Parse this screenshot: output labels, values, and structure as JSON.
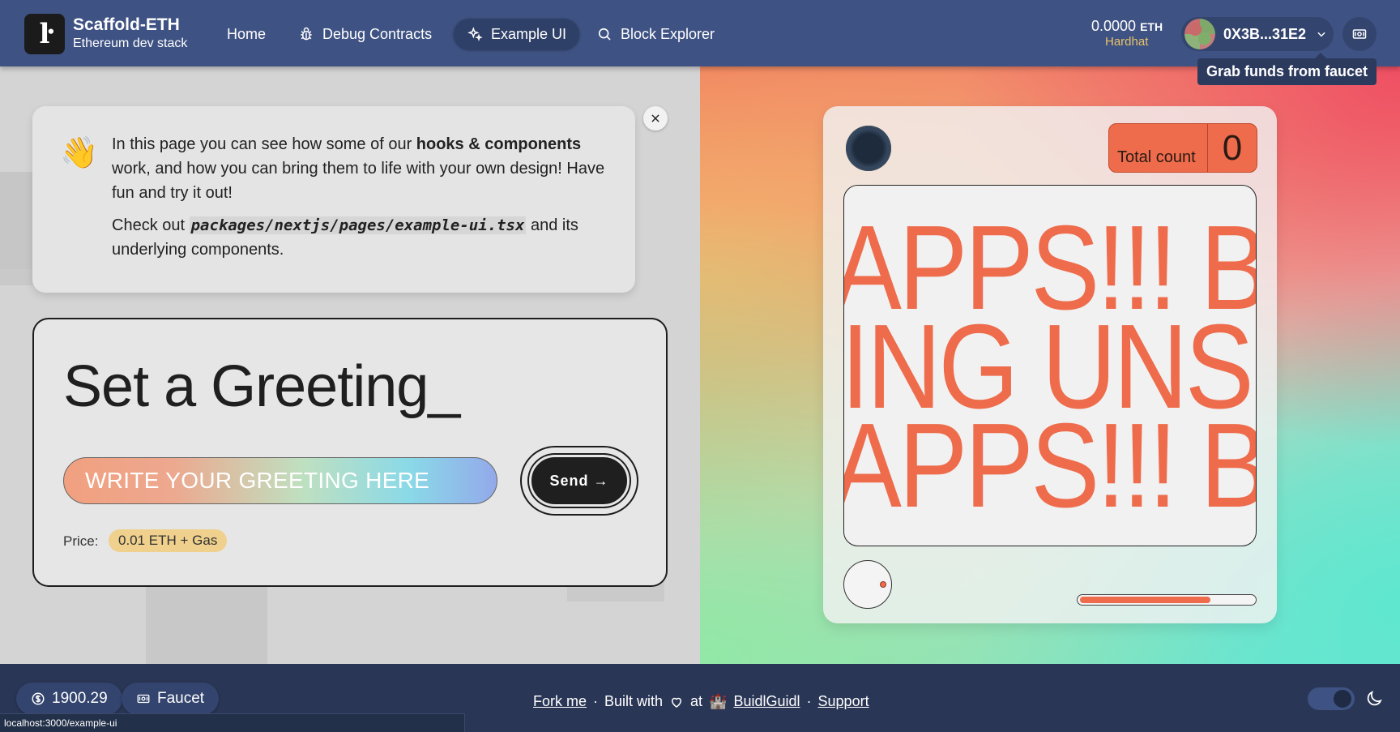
{
  "navbar": {
    "brand_title": "Scaffold-ETH",
    "brand_subtitle": "Ethereum dev stack",
    "links": [
      {
        "label": "Home",
        "icon": "none"
      },
      {
        "label": "Debug Contracts",
        "icon": "bug-icon"
      },
      {
        "label": "Example UI",
        "icon": "sparkles-icon",
        "active": true
      },
      {
        "label": "Block Explorer",
        "icon": "search-icon"
      }
    ],
    "balance": "0.0000",
    "balance_unit": "ETH",
    "network": "Hardhat",
    "network_color": "#e8c26a",
    "address": "0X3B...31E2",
    "faucet_tooltip": "Grab funds from faucet"
  },
  "info": {
    "line1_prefix": "In this page you can see how some of our ",
    "line1_bold": "hooks & components",
    "line1_suffix": " work, and how you can bring them to life with your own design! Have fun and try it out!",
    "line2_prefix": "Check out ",
    "line2_code": "packages/nextjs/pages/example-ui.tsx",
    "line2_suffix": " and its underlying components."
  },
  "greeting": {
    "title": "Set a Greeting_",
    "input_placeholder": "WRITE YOUR GREETING HERE",
    "send_label": "Send →",
    "price_label": "Price:",
    "price_value": "0.01 ETH + Gas"
  },
  "contract_card": {
    "count_label": "Total count",
    "count_value": "0",
    "marquee_lines": [
      "APPS!!! B",
      "ING UNS",
      "APPS!!! B"
    ],
    "accent_color": "#ee6c4c",
    "progress_fraction": 0.75
  },
  "footer": {
    "eth_price": "1900.29",
    "faucet_label": "Faucet",
    "fork_me": "Fork me",
    "built_with": "Built with",
    "at": "at",
    "buidlguidl": "BuidlGuidl",
    "support": "Support",
    "status_url": "localhost:3000/example-ui"
  }
}
